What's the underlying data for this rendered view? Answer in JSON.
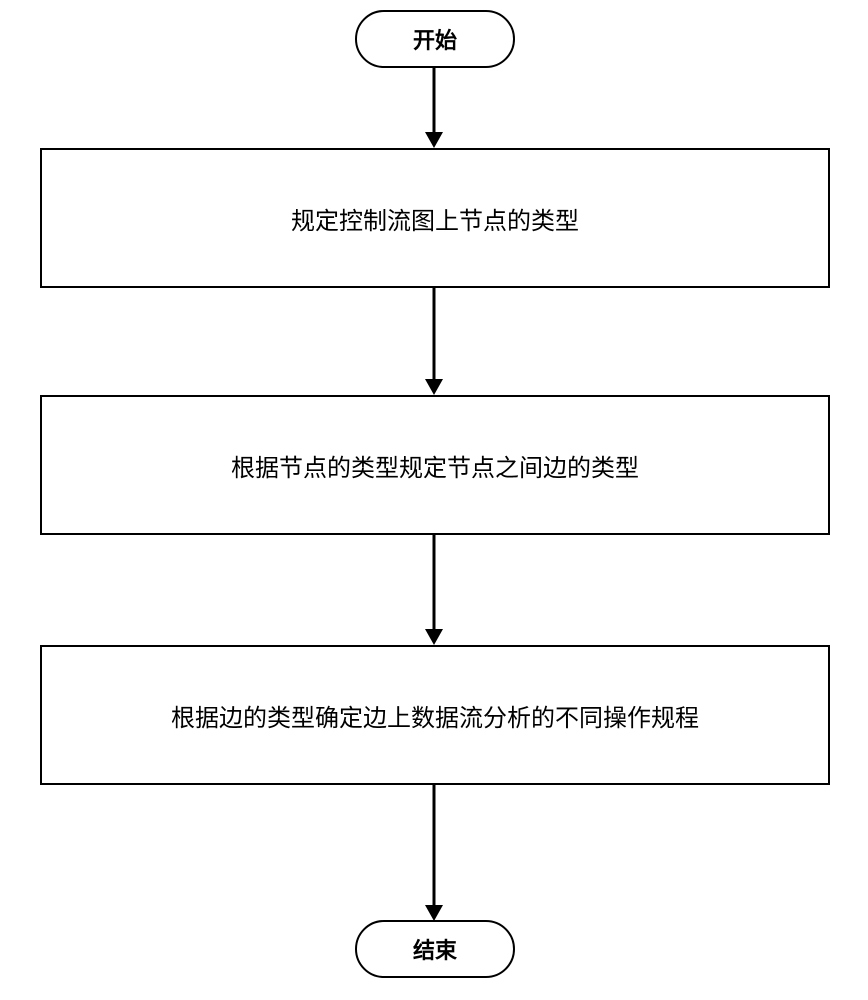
{
  "flowchart": {
    "start": "开始",
    "end": "结束",
    "step1": "规定控制流图上节点的类型",
    "step2": "根据节点的类型规定节点之间边的类型",
    "step3": "根据边的类型确定边上数据流分析的不同操作规程"
  }
}
